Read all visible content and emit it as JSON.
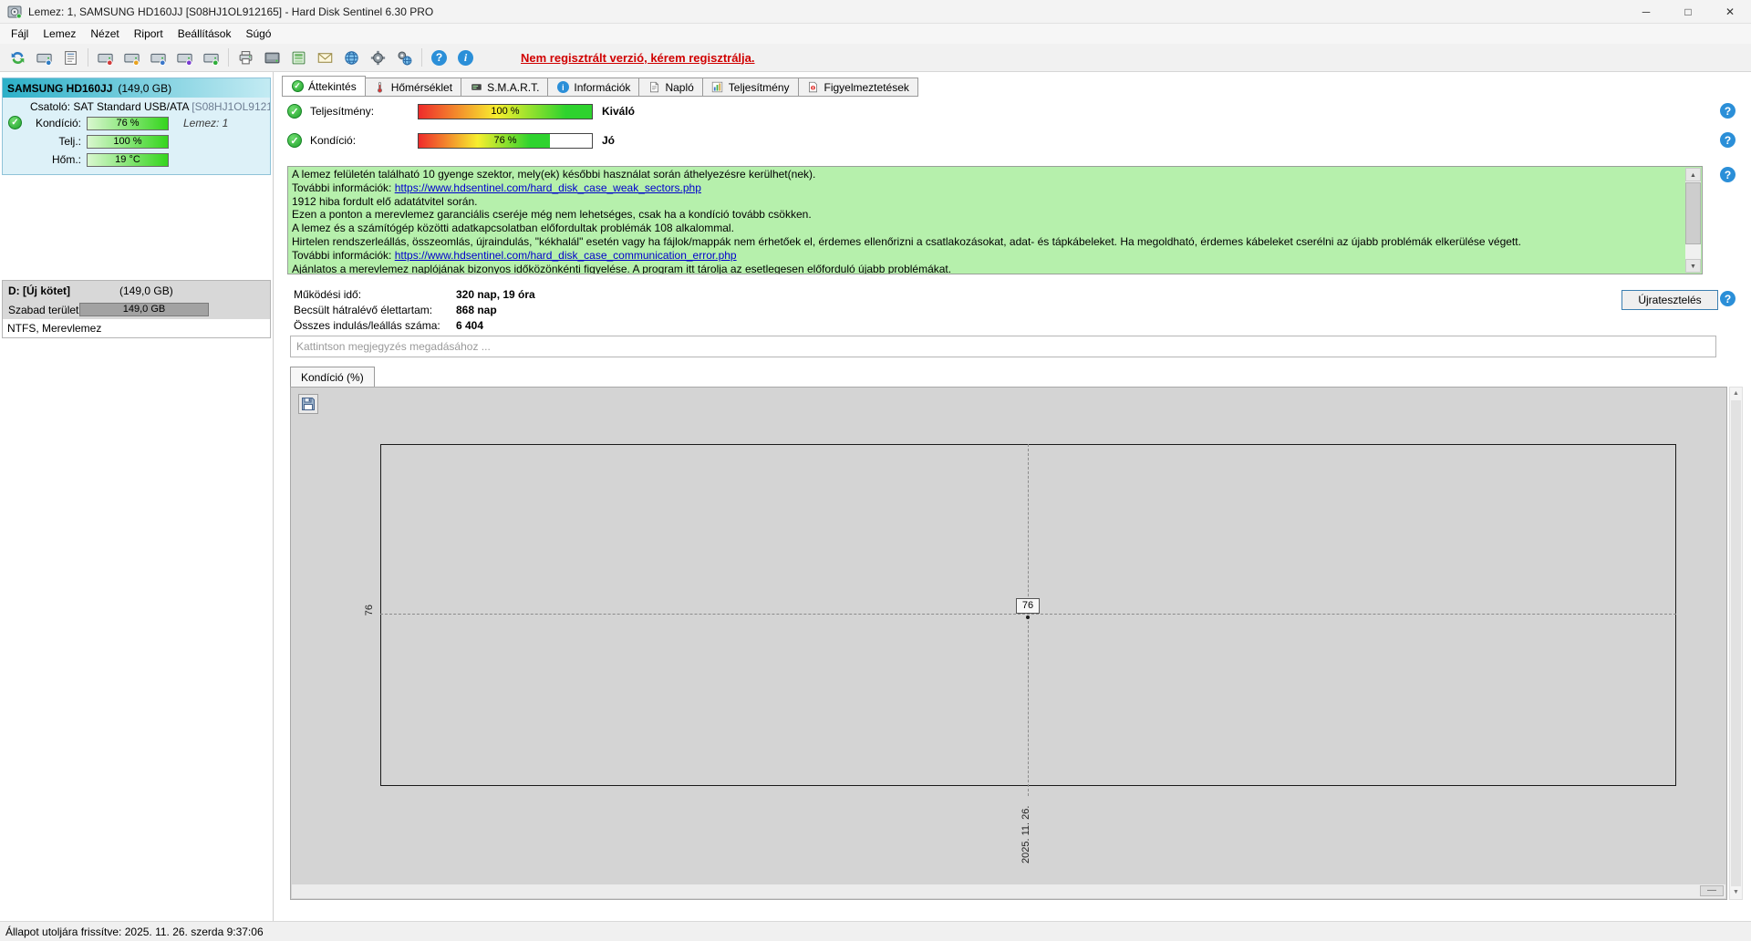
{
  "colors": {
    "accent_teal": "#2cb0c8",
    "selected_bg": "#ddf1f8",
    "message_bg": "#b6f0ac",
    "notice_red": "#d00000",
    "link_blue": "#0000cc",
    "chart_bg": "#d4d4d4",
    "meter_red": "#ef2b2b",
    "meter_yellow": "#f7ef2e",
    "meter_green": "#2ed32e",
    "sidebar_bar_green": "#35d51e",
    "help_blue": "#2b8fd8"
  },
  "window": {
    "title": "Lemez: 1, SAMSUNG HD160JJ [S08HJ1OL912165]  -  Hard Disk Sentinel 6.30 PRO"
  },
  "menu": {
    "items": [
      "Fájl",
      "Lemez",
      "Nézet",
      "Riport",
      "Beállítások",
      "Súgó"
    ]
  },
  "toolbar": {
    "icons": [
      "refresh-icon",
      "disk-refresh-icon",
      "report-list-icon",
      "separator",
      "disk-surface-test-icon",
      "disk-quick-test-icon",
      "disk-short-test-icon",
      "disk-extended-test-icon",
      "disk-info-icon",
      "separator",
      "printer-icon",
      "hdd-icon",
      "card-reader-icon",
      "mail-icon",
      "web-icon",
      "settings-icon",
      "preferences-icon",
      "separator",
      "help-icon",
      "info-icon"
    ],
    "register_notice": "Nem regisztrált verzió, kérem regisztrálja."
  },
  "sidebar": {
    "disk": {
      "name": "SAMSUNG HD160JJ",
      "size": "(149,0 GB)",
      "interface_label": "Csatoló:",
      "interface_value": "SAT Standard USB/ATA",
      "serial": "[S08HJ1OL9121",
      "condition_label": "Kondíció:",
      "condition_value": "76 %",
      "disk_number": "Lemez: 1",
      "performance_label": "Telj.:",
      "performance_value": "100 %",
      "temperature_label": "Hőm.:",
      "temperature_value": "19 °C"
    },
    "volume": {
      "name": "D: [Új kötet]",
      "size": "(149,0 GB)",
      "free_label": "Szabad terület",
      "free_value": "149,0 GB",
      "filesystem": "NTFS, Merevlemez"
    }
  },
  "tabs": [
    {
      "label": "Áttekintés",
      "icon": "check"
    },
    {
      "label": "Hőmérséklet",
      "icon": "thermometer"
    },
    {
      "label": "S.M.A.R.T.",
      "icon": "smart"
    },
    {
      "label": "Információk",
      "icon": "info"
    },
    {
      "label": "Napló",
      "icon": "document"
    },
    {
      "label": "Teljesítmény",
      "icon": "chart"
    },
    {
      "label": "Figyelmeztetések",
      "icon": "warning"
    }
  ],
  "active_tab_index": 0,
  "overview": {
    "performance_label": "Teljesítmény:",
    "performance_value": "100 %",
    "performance_percent": 100,
    "performance_rating": "Kiváló",
    "condition_label": "Kondíció:",
    "condition_value": "76 %",
    "condition_percent": 76,
    "condition_rating": "Jó",
    "message_lines": [
      {
        "segments": [
          {
            "text": "A lemez felületén található 10 gyenge szektor, mely(ek) későbbi használat során áthelyezésre kerülhet(nek)."
          }
        ]
      },
      {
        "segments": [
          {
            "text": "További információk: "
          },
          {
            "text": "https://www.hdsentinel.com/hard_disk_case_weak_sectors.php",
            "link": true
          }
        ]
      },
      {
        "segments": [
          {
            "text": "1912 hiba fordult elő adatátvitel során."
          }
        ]
      },
      {
        "segments": [
          {
            "text": "Ezen a ponton a merevlemez garanciális cseréje még nem lehetséges, csak ha a kondíció tovább csökken."
          }
        ]
      },
      {
        "segments": [
          {
            "text": "A lemez és a számítógép közötti adatkapcsolatban előfordultak problémák 108 alkalommal."
          }
        ]
      },
      {
        "segments": [
          {
            "text": "Hirtelen rendszerleállás, összeomlás, újraindulás, \"kékhalál\" esetén vagy ha fájlok/mappák nem érhetőek el, érdemes ellenőrizni a csatlakozásokat, adat- és tápkábeleket. Ha megoldható, érdemes kábeleket cserélni az újabb problémák elkerülése végett."
          }
        ]
      },
      {
        "segments": [
          {
            "text": "További információk: "
          },
          {
            "text": "https://www.hdsentinel.com/hard_disk_case_communication_error.php",
            "link": true
          }
        ]
      },
      {
        "segments": [
          {
            "text": "Ajánlatos a merevlemez naplójának bizonyos időközönkénti figyelése. A program itt tárolja az esetlegesen előforduló újabb problémákat."
          }
        ]
      }
    ],
    "stats": [
      {
        "label": "Működési idő:",
        "value": "320 nap, 19 óra"
      },
      {
        "label": "Becsült hátralévő élettartam:",
        "value": "868 nap"
      },
      {
        "label": "Összes indulás/leállás száma:",
        "value": "6 404"
      }
    ],
    "retest_button": "Újratesztelés",
    "comment_placeholder": "Kattintson megjegyzés megadásához ..."
  },
  "chart": {
    "tab_label": "Kondíció  (%)",
    "type": "line",
    "x_axis_label": "2025. 11. 26.",
    "y_axis_label": "76",
    "value_label": "76",
    "points": [
      {
        "x": "2025. 11. 26.",
        "y": 76
      }
    ]
  },
  "statusbar": {
    "text": "Állapot utoljára frissítve: 2025. 11. 26. szerda 9:37:06"
  }
}
